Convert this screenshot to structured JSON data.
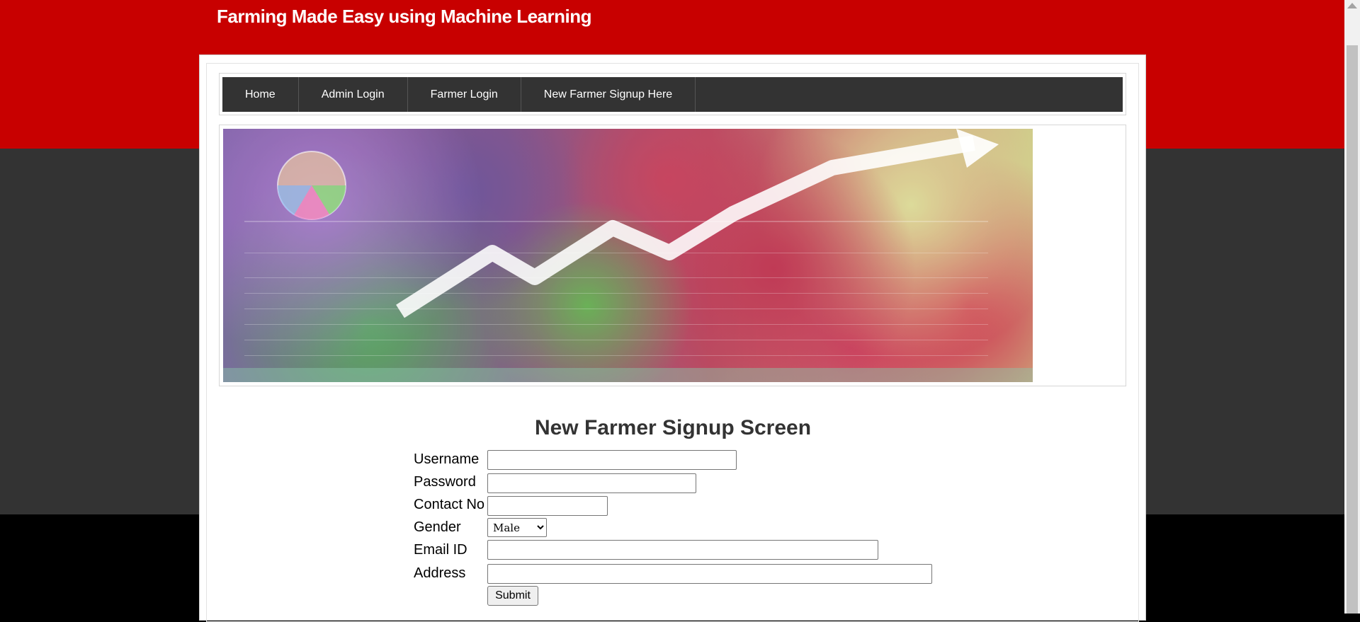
{
  "site": {
    "title": "Farming Made Easy using Machine Learning"
  },
  "nav": {
    "items": [
      {
        "label": "Home"
      },
      {
        "label": "Admin Login"
      },
      {
        "label": "Farmer Login"
      },
      {
        "label": "New Farmer Signup Here"
      }
    ]
  },
  "form": {
    "title": "New Farmer Signup Screen",
    "username_label": "Username",
    "password_label": "Password",
    "contact_label": "Contact No",
    "gender_label": "Gender",
    "gender_selected": "Male",
    "email_label": "Email ID",
    "address_label": "Address",
    "submit_label": "Submit",
    "username_value": "",
    "password_value": "",
    "contact_value": "",
    "email_value": "",
    "address_value": ""
  },
  "colors": {
    "header_red": "#c80000",
    "nav_bg": "#333333",
    "body_dark": "#333333"
  }
}
